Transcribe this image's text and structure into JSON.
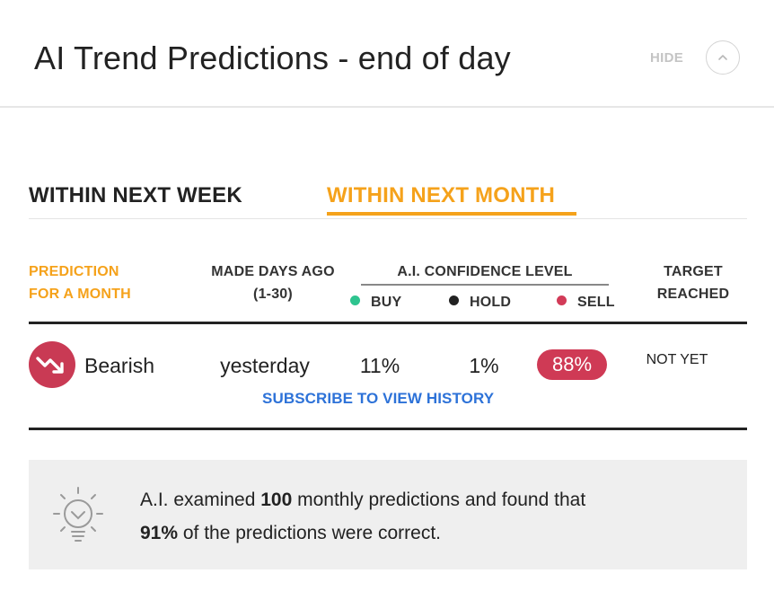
{
  "header": {
    "title": "AI Trend Predictions - end of day",
    "hide_label": "HIDE",
    "collapse_icon": "chevron-up-icon"
  },
  "tabs": [
    {
      "label": "WITHIN NEXT WEEK",
      "active": false
    },
    {
      "label": "WITHIN NEXT MONTH",
      "active": true
    }
  ],
  "columns": {
    "prediction_line1": "PREDICTION",
    "prediction_line2": "FOR A MONTH",
    "made_line1": "MADE DAYS AGO",
    "made_line2": "(1-30)",
    "confidence": "A.I. CONFIDENCE LEVEL",
    "target_line1": "TARGET",
    "target_line2": "REACHED"
  },
  "legend": {
    "buy": {
      "label": "BUY",
      "color": "#2ec48f"
    },
    "hold": {
      "label": "HOLD",
      "color": "#222222"
    },
    "sell": {
      "label": "SELL",
      "color": "#d23b58"
    }
  },
  "prediction": {
    "trend": "Bearish",
    "trend_icon": "trend-down-icon",
    "made": "yesterday",
    "buy": "11%",
    "hold": "1%",
    "sell": "88%",
    "target": "NOT YET"
  },
  "subscribe_link": "SUBSCRIBE TO VIEW HISTORY",
  "info": {
    "icon": "lightbulb-icon",
    "text_1": "A.I. examined ",
    "count": "100",
    "text_2": " monthly predictions and found that",
    "percent": "91%",
    "text_3": " of the predictions were correct."
  },
  "colors": {
    "accent": "#f5a21b",
    "link": "#2d72d8",
    "bearish": "#c93a54",
    "sell_pill": "#cf3a55"
  }
}
